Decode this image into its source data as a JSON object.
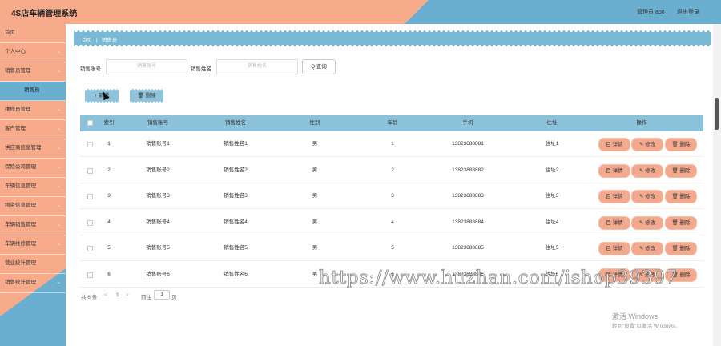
{
  "header": {
    "title": "4S店车辆管理系统",
    "user": "管理员 abo",
    "logout": "退出登录"
  },
  "sidebar": {
    "items": [
      {
        "label": "首页",
        "chevron": false
      },
      {
        "label": "个人中心",
        "chevron": true
      },
      {
        "label": "销售员管理",
        "chevron": true
      },
      {
        "label": "销售员",
        "chevron": false,
        "sub": true
      },
      {
        "label": "维修员管理",
        "chevron": true
      },
      {
        "label": "客户管理",
        "chevron": true
      },
      {
        "label": "供应商信息管理",
        "chevron": true
      },
      {
        "label": "保险公司管理",
        "chevron": true
      },
      {
        "label": "车辆信息管理",
        "chevron": true
      },
      {
        "label": "物资信息管理",
        "chevron": true
      },
      {
        "label": "车辆销售管理",
        "chevron": true
      },
      {
        "label": "车辆维修管理",
        "chevron": true
      },
      {
        "label": "营业统计管理",
        "chevron": false
      },
      {
        "label": "销售统计管理",
        "chevron": true
      }
    ]
  },
  "breadcrumb": {
    "home": "首页",
    "current": "销售员"
  },
  "search": {
    "account_label": "销售账号",
    "account_placeholder": "销售账号",
    "name_label": "销售姓名",
    "name_placeholder": "销售姓名",
    "query_button": "Q 查询"
  },
  "actions": {
    "add": "+ 新增",
    "delete": "🗑 删除"
  },
  "table": {
    "headers": [
      "索引",
      "销售账号",
      "销售姓名",
      "性别",
      "年龄",
      "手机",
      "住址",
      "操作"
    ],
    "rows": [
      [
        "1",
        "销售账号1",
        "销售姓名1",
        "男",
        "1",
        "13823888881",
        "住址1"
      ],
      [
        "2",
        "销售账号2",
        "销售姓名2",
        "男",
        "2",
        "13823888882",
        "住址2"
      ],
      [
        "3",
        "销售账号3",
        "销售姓名3",
        "男",
        "3",
        "13823888883",
        "住址3"
      ],
      [
        "4",
        "销售账号4",
        "销售姓名4",
        "男",
        "4",
        "13823888884",
        "住址4"
      ],
      [
        "5",
        "销售账号5",
        "销售姓名5",
        "男",
        "5",
        "13823888885",
        "住址5"
      ],
      [
        "6",
        "销售账号6",
        "销售姓名6",
        "男",
        "6",
        "13823888886",
        "住址6"
      ]
    ],
    "row_actions": [
      "目 详情",
      "✎ 修改",
      "🗑 删除"
    ]
  },
  "pagination": {
    "total": "共 6 条",
    "prev": "<",
    "current_page": "1",
    "next": ">",
    "goto": "前往",
    "page_input": "1",
    "page_unit": "页"
  },
  "watermark": "https://www.huzhan.com/ishop39397",
  "windows_activation": {
    "line1": "激活 Windows",
    "line2": "转到\"设置\"以激活 Windows。"
  },
  "colors": {
    "salmon": "#f8ab8a",
    "blue": "#6aaed0",
    "table_header": "#8cc1da",
    "row_button": "#f3a98e"
  }
}
